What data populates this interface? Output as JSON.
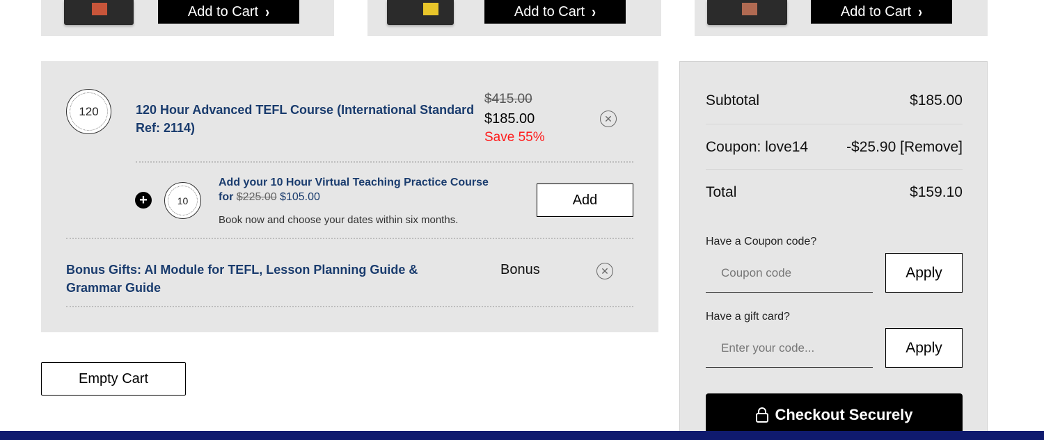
{
  "upsells": [
    {
      "button_label": "Add to Cart"
    },
    {
      "button_label": "Add to Cart"
    },
    {
      "button_label": "Add to Cart"
    }
  ],
  "cart": {
    "main_item": {
      "badge": "120",
      "title": "120 Hour Advanced TEFL Course (International Standard Ref: 2114)",
      "price_original": "$415.00",
      "price_current": "$185.00",
      "savings": "Save 55%"
    },
    "addon": {
      "badge": "10",
      "title": "Add your 10 Hour Virtual Teaching Practice Course",
      "for_label": "for",
      "price_original": "$225.00",
      "price_current": "$105.00",
      "note": "Book now and choose your dates within six months.",
      "add_label": "Add"
    },
    "bonus_item": {
      "title": "Bonus Gifts: AI Module for TEFL, Lesson Planning Guide & Grammar Guide",
      "price_label": "Bonus"
    },
    "empty_label": "Empty Cart"
  },
  "summary": {
    "subtotal_label": "Subtotal",
    "subtotal_value": "$185.00",
    "coupon_label": "Coupon: love14",
    "coupon_value": "-$25.90 [Remove]",
    "total_label": "Total",
    "total_value": "$159.10",
    "coupon_prompt": "Have a Coupon code?",
    "coupon_placeholder": "Coupon code",
    "gift_prompt": "Have a gift card?",
    "gift_placeholder": "Enter your code...",
    "apply_label": "Apply",
    "checkout_label": "Checkout Securely"
  },
  "colors": {
    "title_blue": "#1a3c6e",
    "save_red": "#ff1a1a",
    "footer_navy": "#0f1a6e"
  }
}
